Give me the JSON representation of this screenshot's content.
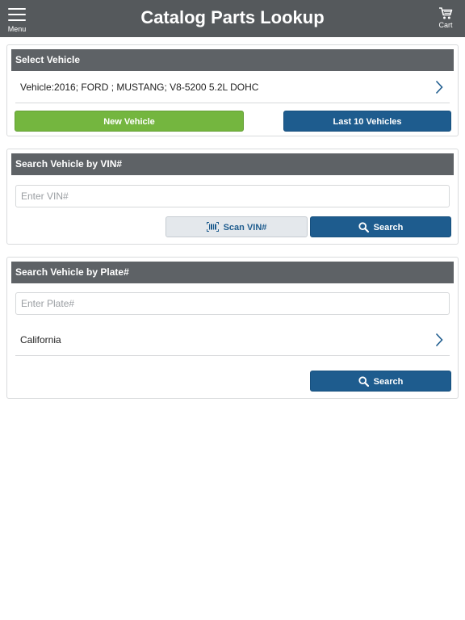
{
  "header": {
    "title": "Catalog Parts Lookup",
    "menu_label": "Menu",
    "cart_label": "Cart"
  },
  "select_vehicle": {
    "heading": "Select Vehicle",
    "vehicle_text": "Vehicle:2016; FORD ; MUSTANG; V8-5200 5.2L DOHC",
    "new_vehicle_label": "New Vehicle",
    "last_vehicles_label": "Last 10 Vehicles"
  },
  "vin_search": {
    "heading": "Search Vehicle by VIN#",
    "placeholder": "Enter VIN#",
    "value": "",
    "scan_label": "Scan VIN#",
    "search_label": "Search"
  },
  "plate_search": {
    "heading": "Search Vehicle by Plate#",
    "placeholder": "Enter Plate#",
    "value": "",
    "state": "California",
    "search_label": "Search"
  },
  "colors": {
    "header_bg": "#55595c",
    "section_header_bg": "#5e6266",
    "accent_green": "#74b63f",
    "accent_blue": "#1e5c8e"
  },
  "icons": [
    "menu-icon",
    "cart-icon",
    "chevron-right-icon",
    "barcode-icon",
    "search-icon"
  ]
}
